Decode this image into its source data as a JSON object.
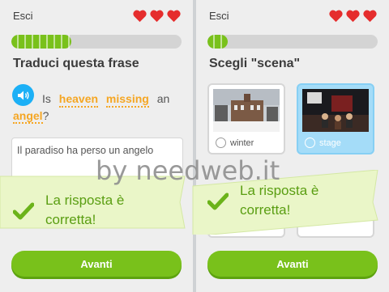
{
  "left": {
    "exit_label": "Esci",
    "hearts": 3,
    "progress": 0.35,
    "title": "Traduci questa frase",
    "sentence_words": [
      {
        "text": "Is",
        "highlight": false
      },
      {
        "text": "heaven",
        "highlight": true
      },
      {
        "text": "missing",
        "highlight": true
      },
      {
        "text": "an",
        "highlight": false
      }
    ],
    "sentence_end_word": "angel",
    "sentence_end_punct": "?",
    "answer": "Il paradiso ha perso un angelo",
    "button_label": "Avanti"
  },
  "right": {
    "exit_label": "Esci",
    "hearts": 3,
    "progress": 0.12,
    "title": "Scegli \"scena\"",
    "options": [
      {
        "label": "winter",
        "selected": false
      },
      {
        "label": "stage",
        "selected": true
      }
    ],
    "button_label": "Avanti"
  },
  "feedback": {
    "message": "La risposta è corretta!"
  },
  "watermark": "by needweb.it",
  "colors": {
    "accent_green": "#79c11b",
    "heart_red": "#e52d2d",
    "highlight_orange": "#f5a623",
    "selected_blue": "#a4dcf8",
    "banner_bg": "#eaf6c8"
  }
}
